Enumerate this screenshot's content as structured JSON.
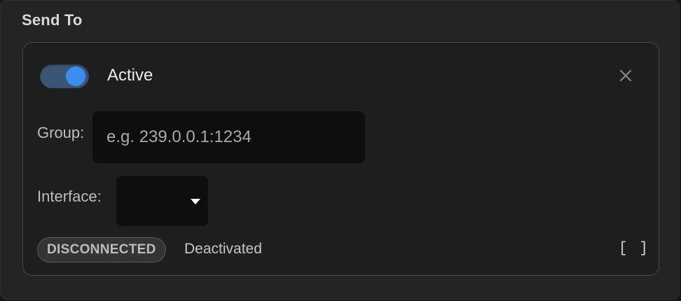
{
  "section": {
    "title": "Send To"
  },
  "card": {
    "toggle": {
      "on": true,
      "label": "Active"
    },
    "close_icon": "close-icon",
    "group": {
      "label": "Group:",
      "value": "",
      "placeholder": "e.g. 239.0.0.1:1234"
    },
    "interface": {
      "label": "Interface:",
      "selected": ""
    },
    "status": {
      "badge": "DISCONNECTED",
      "text": "Deactivated",
      "brackets": "[ ]"
    }
  },
  "colors": {
    "accent": "#3d8df0",
    "toggle_track": "#3b5576",
    "panel_bg": "#242424",
    "input_bg": "#0e0e0e"
  }
}
